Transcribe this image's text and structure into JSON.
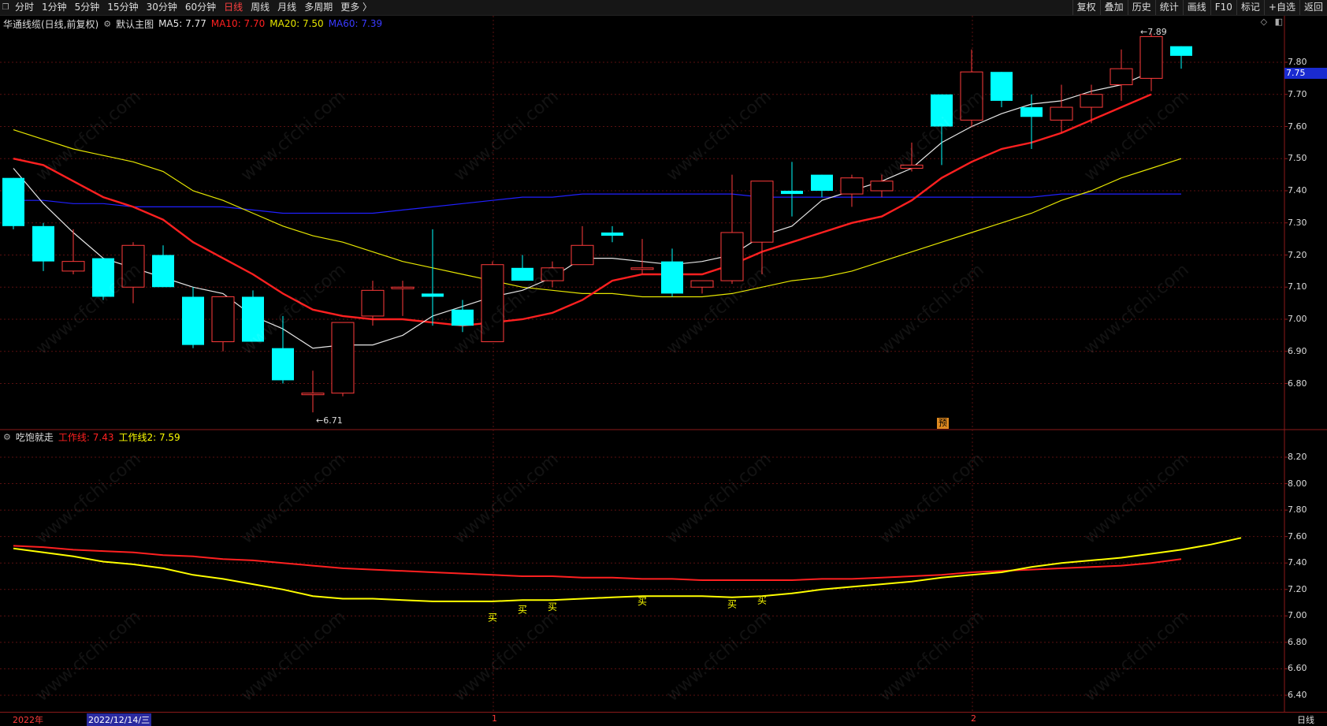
{
  "toolbar": {
    "app_icon": "window-icon",
    "periods": [
      "分时",
      "1分钟",
      "5分钟",
      "15分钟",
      "30分钟",
      "60分钟",
      "日线",
      "周线",
      "月线",
      "多周期",
      "更多 〉"
    ],
    "active_period": "日线",
    "right_buttons": [
      "复权",
      "叠加",
      "历史",
      "统计",
      "画线",
      "F10",
      "标记",
      "+自选",
      "返回"
    ]
  },
  "main_pane": {
    "title": "华通线缆(日线,前复权)",
    "template": "默认主图",
    "ma5": "MA5: 7.77",
    "ma10": "MA10: 7.70",
    "ma20": "MA20: 7.50",
    "ma60": "MA60: 7.39",
    "current_price": "7.75",
    "high_marker": "7.89",
    "low_marker": "6.71",
    "forecast_badge": "预",
    "y_ticks": [
      "7.80",
      "7.70",
      "7.60",
      "7.50",
      "7.40",
      "7.30",
      "7.20",
      "7.10",
      "7.00",
      "6.90",
      "6.80"
    ]
  },
  "sub_pane": {
    "title": "吃饱就走",
    "line1": "工作线: 7.43",
    "line2": "工作线2: 7.59",
    "buy_label": "买",
    "y_ticks": [
      "8.20",
      "8.00",
      "7.80",
      "7.60",
      "7.40",
      "7.20",
      "7.00",
      "6.80",
      "6.60",
      "6.40"
    ]
  },
  "date_bar": {
    "year": "2022年",
    "cursor_date": "2022/12/14/三",
    "month1": "1",
    "month2": "2",
    "period": "日线"
  },
  "watermark": "www.cfchi.com",
  "colors": {
    "up": "#ff3b3b",
    "down": "#00ffff",
    "ma5": "#e6e6e6",
    "ma10": "#ff2020",
    "ma20": "#e6e600",
    "ma60": "#2020ff",
    "work1": "#ff2020",
    "work2": "#ffff00"
  },
  "chart_data": {
    "type": "candlestick",
    "candles": [
      {
        "o": 7.44,
        "h": 7.44,
        "l": 7.28,
        "c": 7.29
      },
      {
        "o": 7.29,
        "h": 7.3,
        "l": 7.15,
        "c": 7.18
      },
      {
        "o": 7.15,
        "h": 7.28,
        "l": 7.14,
        "c": 7.18
      },
      {
        "o": 7.19,
        "h": 7.19,
        "l": 7.06,
        "c": 7.07
      },
      {
        "o": 7.1,
        "h": 7.24,
        "l": 7.05,
        "c": 7.23
      },
      {
        "o": 7.2,
        "h": 7.23,
        "l": 7.1,
        "c": 7.1
      },
      {
        "o": 7.07,
        "h": 7.1,
        "l": 6.91,
        "c": 6.92
      },
      {
        "o": 6.93,
        "h": 7.07,
        "l": 6.9,
        "c": 7.07
      },
      {
        "o": 7.07,
        "h": 7.09,
        "l": 6.93,
        "c": 6.93
      },
      {
        "o": 6.91,
        "h": 7.01,
        "l": 6.8,
        "c": 6.81
      },
      {
        "o": 6.77,
        "h": 6.84,
        "l": 6.71,
        "c": 6.77
      },
      {
        "o": 6.77,
        "h": 6.99,
        "l": 6.76,
        "c": 6.99
      },
      {
        "o": 7.01,
        "h": 7.12,
        "l": 6.98,
        "c": 7.09
      },
      {
        "o": 7.1,
        "h": 7.12,
        "l": 7.01,
        "c": 7.1
      },
      {
        "o": 7.08,
        "h": 7.28,
        "l": 6.98,
        "c": 7.07
      },
      {
        "o": 7.03,
        "h": 7.06,
        "l": 6.96,
        "c": 6.98
      },
      {
        "o": 6.93,
        "h": 7.18,
        "l": 6.93,
        "c": 7.17
      },
      {
        "o": 7.16,
        "h": 7.2,
        "l": 7.12,
        "c": 7.12
      },
      {
        "o": 7.12,
        "h": 7.18,
        "l": 7.1,
        "c": 7.16
      },
      {
        "o": 7.17,
        "h": 7.29,
        "l": 7.17,
        "c": 7.23
      },
      {
        "o": 7.27,
        "h": 7.29,
        "l": 7.24,
        "c": 7.26
      },
      {
        "o": 7.16,
        "h": 7.25,
        "l": 7.14,
        "c": 7.16
      },
      {
        "o": 7.18,
        "h": 7.22,
        "l": 7.07,
        "c": 7.08
      },
      {
        "o": 7.1,
        "h": 7.12,
        "l": 7.08,
        "c": 7.12
      },
      {
        "o": 7.12,
        "h": 7.45,
        "l": 7.11,
        "c": 7.27
      },
      {
        "o": 7.24,
        "h": 7.43,
        "l": 7.14,
        "c": 7.43
      },
      {
        "o": 7.4,
        "h": 7.49,
        "l": 7.32,
        "c": 7.39
      },
      {
        "o": 7.45,
        "h": 7.45,
        "l": 7.38,
        "c": 7.4
      },
      {
        "o": 7.39,
        "h": 7.45,
        "l": 7.35,
        "c": 7.44
      },
      {
        "o": 7.4,
        "h": 7.45,
        "l": 7.38,
        "c": 7.43
      },
      {
        "o": 7.47,
        "h": 7.55,
        "l": 7.46,
        "c": 7.48
      },
      {
        "o": 7.7,
        "h": 7.7,
        "l": 7.48,
        "c": 7.6
      },
      {
        "o": 7.62,
        "h": 7.84,
        "l": 7.6,
        "c": 7.77
      },
      {
        "o": 7.77,
        "h": 7.77,
        "l": 7.66,
        "c": 7.68
      },
      {
        "o": 7.66,
        "h": 7.7,
        "l": 7.53,
        "c": 7.63
      },
      {
        "o": 7.62,
        "h": 7.73,
        "l": 7.58,
        "c": 7.66
      },
      {
        "o": 7.66,
        "h": 7.73,
        "l": 7.61,
        "c": 7.7
      },
      {
        "o": 7.73,
        "h": 7.84,
        "l": 7.68,
        "c": 7.78
      },
      {
        "o": 7.75,
        "h": 7.89,
        "l": 7.71,
        "c": 7.88
      },
      {
        "o": 7.85,
        "h": 7.85,
        "l": 7.78,
        "c": 7.82
      }
    ],
    "ma5": [
      7.47,
      7.36,
      7.27,
      7.19,
      7.16,
      7.13,
      7.1,
      7.08,
      7.01,
      6.97,
      6.91,
      6.92,
      6.92,
      6.95,
      7.01,
      7.04,
      7.07,
      7.09,
      7.13,
      7.19,
      7.19,
      7.18,
      7.17,
      7.18,
      7.2,
      7.26,
      7.29,
      7.37,
      7.4,
      7.43,
      7.47,
      7.55,
      7.6,
      7.64,
      7.67,
      7.68,
      7.71,
      7.73,
      7.77
    ],
    "ma10": [
      7.5,
      7.48,
      7.43,
      7.38,
      7.35,
      7.31,
      7.24,
      7.19,
      7.14,
      7.08,
      7.03,
      7.01,
      7.0,
      7.0,
      6.99,
      6.98,
      6.99,
      7.0,
      7.02,
      7.06,
      7.12,
      7.14,
      7.14,
      7.14,
      7.17,
      7.21,
      7.24,
      7.27,
      7.3,
      7.32,
      7.37,
      7.44,
      7.49,
      7.53,
      7.55,
      7.58,
      7.62,
      7.66,
      7.7
    ],
    "ma20": [
      7.59,
      7.56,
      7.53,
      7.51,
      7.49,
      7.46,
      7.4,
      7.37,
      7.33,
      7.29,
      7.26,
      7.24,
      7.21,
      7.18,
      7.16,
      7.14,
      7.12,
      7.1,
      7.09,
      7.08,
      7.08,
      7.07,
      7.07,
      7.07,
      7.08,
      7.1,
      7.12,
      7.13,
      7.15,
      7.18,
      7.21,
      7.24,
      7.27,
      7.3,
      7.33,
      7.37,
      7.4,
      7.44,
      7.47,
      7.5
    ],
    "ma60": [
      7.37,
      7.37,
      7.36,
      7.36,
      7.35,
      7.35,
      7.35,
      7.35,
      7.34,
      7.33,
      7.33,
      7.33,
      7.33,
      7.34,
      7.35,
      7.36,
      7.37,
      7.38,
      7.38,
      7.39,
      7.39,
      7.39,
      7.39,
      7.39,
      7.39,
      7.38,
      7.38,
      7.38,
      7.38,
      7.38,
      7.38,
      7.38,
      7.38,
      7.38,
      7.38,
      7.39,
      7.39,
      7.39,
      7.39,
      7.39
    ],
    "work_line": [
      7.53,
      7.52,
      7.5,
      7.49,
      7.48,
      7.46,
      7.45,
      7.43,
      7.42,
      7.4,
      7.38,
      7.36,
      7.35,
      7.34,
      7.33,
      7.32,
      7.31,
      7.3,
      7.3,
      7.29,
      7.29,
      7.28,
      7.28,
      7.27,
      7.27,
      7.27,
      7.27,
      7.28,
      7.28,
      7.29,
      7.3,
      7.31,
      7.33,
      7.34,
      7.35,
      7.36,
      7.37,
      7.38,
      7.4,
      7.43
    ],
    "work_line2": [
      7.51,
      7.48,
      7.45,
      7.41,
      7.39,
      7.36,
      7.31,
      7.28,
      7.24,
      7.2,
      7.15,
      7.13,
      7.13,
      7.12,
      7.11,
      7.11,
      7.11,
      7.12,
      7.12,
      7.13,
      7.14,
      7.15,
      7.15,
      7.15,
      7.14,
      7.15,
      7.17,
      7.2,
      7.22,
      7.24,
      7.26,
      7.29,
      7.31,
      7.33,
      7.37,
      7.4,
      7.42,
      7.44,
      7.47,
      7.5,
      7.54,
      7.59
    ],
    "buy_signals": [
      {
        "i": 16,
        "y": 7.0
      },
      {
        "i": 17,
        "y": 7.06
      },
      {
        "i": 18,
        "y": 7.08
      },
      {
        "i": 21,
        "y": 7.12
      },
      {
        "i": 24,
        "y": 7.1
      },
      {
        "i": 25,
        "y": 7.13
      }
    ],
    "main_ylim": [
      6.7,
      7.92
    ],
    "sub_ylim": [
      6.3,
      8.3
    ]
  }
}
